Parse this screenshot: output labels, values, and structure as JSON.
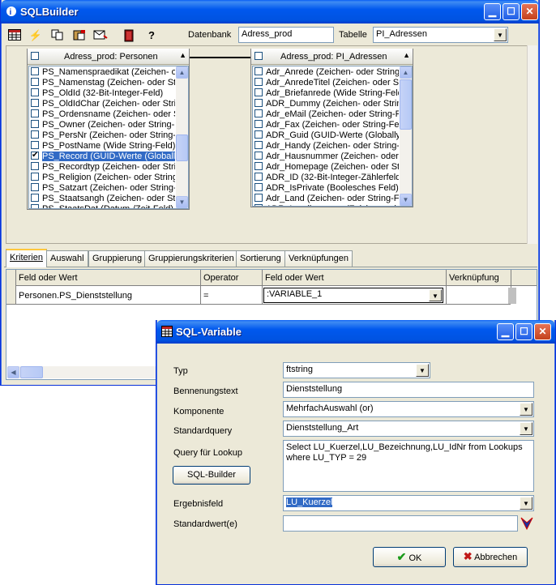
{
  "main_window": {
    "title": "SQLBuilder",
    "toolbar": {
      "db_label": "Datenbank",
      "db_value": "Adress_prod",
      "table_label": "Tabelle",
      "table_value": "PI_Adressen",
      "help": "?"
    },
    "left_table": {
      "header": "Adress_prod: Personen",
      "rows": [
        {
          "text": "PS_Namenspraedikat (Zeichen- oder String-Feld)",
          "checked": false,
          "selected": false
        },
        {
          "text": "PS_Namenstag (Zeichen- oder String-Feld)",
          "checked": false,
          "selected": false
        },
        {
          "text": "PS_OldId (32-Bit-Integer-Feld)",
          "checked": false,
          "selected": false
        },
        {
          "text": "PS_OldIdChar (Zeichen- oder String-Feld)",
          "checked": false,
          "selected": false
        },
        {
          "text": "PS_Ordensname (Zeichen- oder String-Feld)",
          "checked": false,
          "selected": false
        },
        {
          "text": "PS_Owner (Zeichen- oder String-Feld)",
          "checked": false,
          "selected": false
        },
        {
          "text": "PS_PersNr (Zeichen- oder String-Feld)",
          "checked": false,
          "selected": false
        },
        {
          "text": "PS_PostName (Wide String-Feld)",
          "checked": false,
          "selected": false
        },
        {
          "text": "PS_Record (GUID-Werte (Globally",
          "checked": true,
          "selected": true
        },
        {
          "text": "PS_Recordtyp (Zeichen- oder String-Feld)",
          "checked": false,
          "selected": false
        },
        {
          "text": "PS_Religion (Zeichen- oder String-Feld)",
          "checked": false,
          "selected": false
        },
        {
          "text": "PS_Satzart (Zeichen- oder String-Feld)",
          "checked": false,
          "selected": false
        },
        {
          "text": "PS_Staatsangh (Zeichen- oder String-Feld)",
          "checked": false,
          "selected": false
        },
        {
          "text": "PS_StaatsDat (Datum-/Zeit-Feld)",
          "checked": false,
          "selected": false
        }
      ]
    },
    "right_table": {
      "header": "Adress_prod: PI_Adressen",
      "rows": [
        {
          "text": "Adr_Anrede (Zeichen- oder String-Feld)"
        },
        {
          "text": "Adr_AnredeTitel (Zeichen- oder String-Feld)"
        },
        {
          "text": "Adr_Briefanrede (Wide String-Feld)"
        },
        {
          "text": "ADR_Dummy (Zeichen- oder String-Feld)"
        },
        {
          "text": "Adr_eMail (Zeichen- oder String-Feld)"
        },
        {
          "text": "Adr_Fax (Zeichen- oder String-Feld)"
        },
        {
          "text": "ADR_Guid (GUID-Werte (Globally"
        },
        {
          "text": "Adr_Handy (Zeichen- oder String-Feld)"
        },
        {
          "text": "Adr_Hausnummer (Zeichen- oder String-Feld)"
        },
        {
          "text": "Adr_Homepage (Zeichen- oder String-Feld)"
        },
        {
          "text": "ADR_ID (32-Bit-Integer-Zählerfeld)"
        },
        {
          "text": "ADR_IsPrivate (Boolesches Feld)"
        },
        {
          "text": "Adr_Land (Zeichen- oder String-Feld)"
        },
        {
          "text": "ADR_Landkennung (Zeichen- oder String-Feld)"
        }
      ]
    },
    "tabs": [
      "Kriterien",
      "Auswahl",
      "Gruppierung",
      "Gruppierungskriterien",
      "Sortierung",
      "Verknüpfungen"
    ],
    "grid": {
      "headers": [
        "Feld oder Wert",
        "Operator",
        "Feld oder Wert",
        "Verknüpfung"
      ],
      "row": [
        "Personen.PS_Dienststellung",
        "=",
        ":VARIABLE_1",
        ""
      ]
    }
  },
  "dialog": {
    "title": "SQL-Variable",
    "fields": {
      "typ_label": "Typ",
      "typ_value": "ftstring",
      "benennung_label": "Bennenungstext",
      "benennung_value": "Dienststellung",
      "komponente_label": "Komponente",
      "komponente_value": "MehrfachAuswahl (or)",
      "standardquery_label": "Standardquery",
      "standardquery_value": "Dienststellung_Art",
      "lookup_label": "Query für Lookup",
      "lookup_value": "Select LU_Kuerzel,LU_Bezeichnung,LU_IdNr from Lookups where LU_TYP = 29",
      "sqlbuilder_btn": "SQL-Builder",
      "ergebnis_label": "Ergebnisfeld",
      "ergebnis_value": "LU_Kuerzel",
      "standardwert_label": "Standardwert(e)",
      "standardwert_value": ""
    },
    "ok": "OK",
    "cancel": "Abbrechen"
  }
}
